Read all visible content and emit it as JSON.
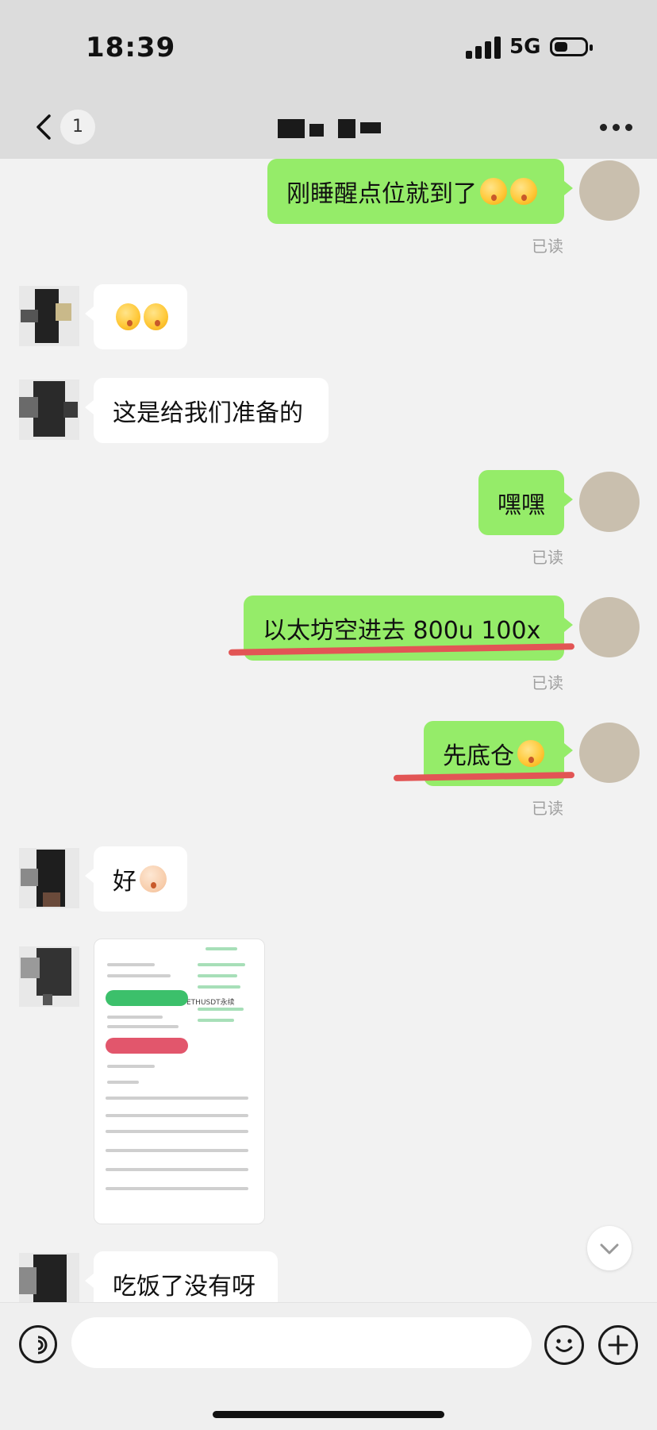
{
  "status_bar": {
    "time": "18:39",
    "network": "5G",
    "battery_level": 0.45
  },
  "nav": {
    "unread_badge": "1",
    "back_icon": "chevron-left-icon",
    "more_icon": "more-icon"
  },
  "messages": [
    {
      "from": "me",
      "text": "刚睡醒点位就到了",
      "emoji": [
        "face-emoji",
        "face-emoji"
      ],
      "read": "已读"
    },
    {
      "from": "them",
      "text": "",
      "emoji": [
        "thinking-emoji",
        "eyes-emoji"
      ]
    },
    {
      "from": "them",
      "text": "这是给我们准备的"
    },
    {
      "from": "me",
      "text": "嘿嘿",
      "read": "已读"
    },
    {
      "from": "me",
      "text": "以太坊空进去 800u 100x",
      "read": "已读",
      "underlined": true
    },
    {
      "from": "me",
      "text": "先底仓",
      "emoji": [
        "face-emoji"
      ],
      "read": "已读",
      "underlined": true
    },
    {
      "from": "them",
      "text": "好",
      "emoji": [
        "ok-hand-emoji"
      ]
    },
    {
      "from": "them",
      "type": "image",
      "image_caption": "ETHUSDT永续"
    },
    {
      "from": "them",
      "text": "吃饭了没有呀"
    }
  ],
  "colors": {
    "outgoing_bubble": "#95ec69",
    "incoming_bubble": "#ffffff",
    "underline": "#e25555",
    "background": "#f2f2f2"
  },
  "input_bar": {
    "voice_icon": "voice-icon",
    "emoji_icon": "emoji-icon",
    "plus_icon": "plus-icon",
    "text_value": ""
  }
}
